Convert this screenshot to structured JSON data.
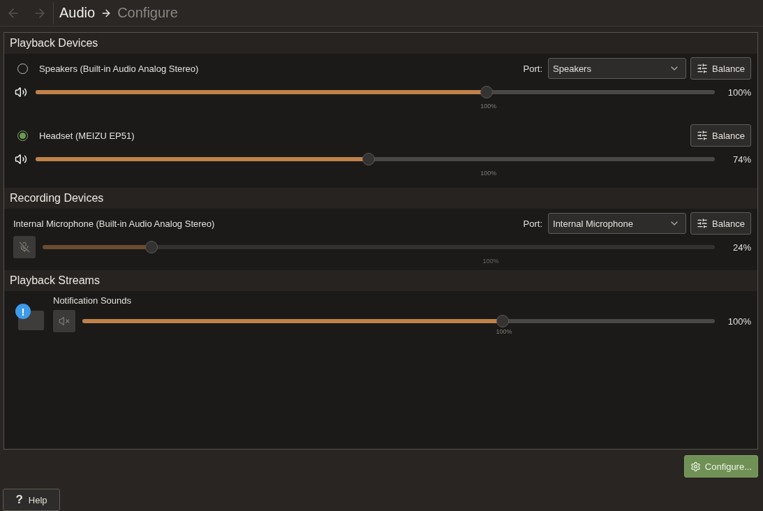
{
  "nav": {
    "breadcrumb": [
      "Audio",
      "Configure"
    ]
  },
  "sections": [
    {
      "kind": "playback",
      "title": "Playback Devices",
      "items": [
        {
          "name": "Speakers (Built-in Audio Analog Stereo)",
          "selected": false,
          "port_label": "Port:",
          "port": "Speakers",
          "balance": "Balance",
          "muted": false,
          "level": 0.664,
          "reading": "100%",
          "tick": "100%"
        },
        {
          "name": "Headset (MEIZU EP51)",
          "selected": true,
          "balance": "Balance",
          "muted": false,
          "level": 0.49,
          "reading": "74%",
          "tick": "100%"
        }
      ]
    },
    {
      "kind": "recording",
      "title": "Recording Devices",
      "items": [
        {
          "name": "Internal Microphone (Built-in Audio Analog Stereo)",
          "port_label": "Port:",
          "port": "Internal Microphone",
          "balance": "Balance",
          "muted": true,
          "level": 0.162,
          "reading": "24%",
          "tick": "100%"
        }
      ]
    },
    {
      "kind": "stream",
      "title": "Playback Streams",
      "items": [
        {
          "name": "Notification Sounds",
          "badge": "!",
          "muted": true,
          "level": 0.664,
          "reading": "100%",
          "tick": "100%"
        }
      ]
    }
  ],
  "footer": {
    "configure": "Configure...",
    "help_icon": "?",
    "help": "Help"
  }
}
